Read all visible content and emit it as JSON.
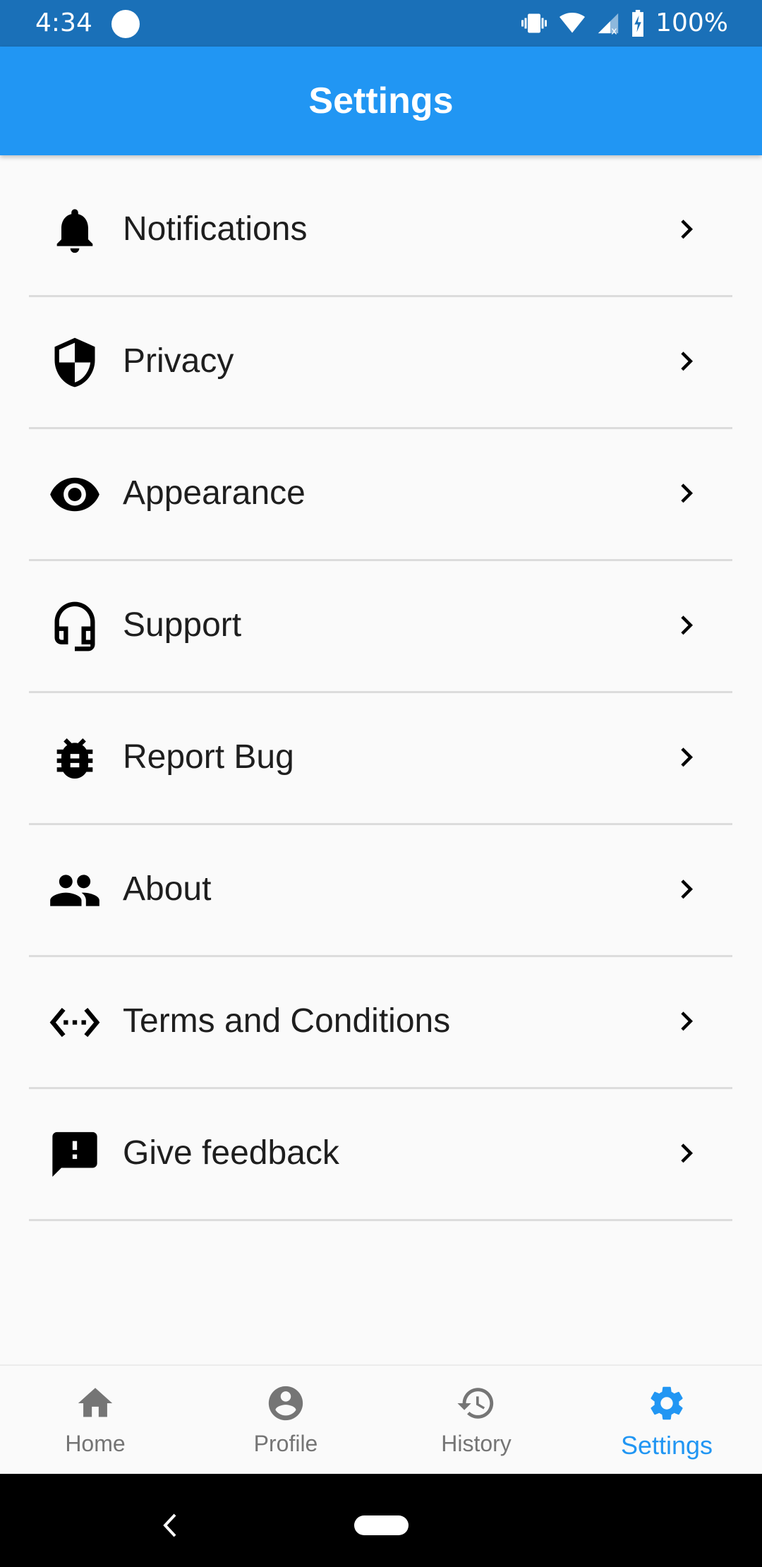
{
  "status_bar": {
    "time": "4:34",
    "battery": "100%"
  },
  "header": {
    "title": "Settings"
  },
  "settings": [
    {
      "label": "Notifications",
      "icon": "bell-icon"
    },
    {
      "label": "Privacy",
      "icon": "shield-icon"
    },
    {
      "label": "Appearance",
      "icon": "eye-icon"
    },
    {
      "label": "Support",
      "icon": "headset-icon"
    },
    {
      "label": "Report Bug",
      "icon": "bug-icon"
    },
    {
      "label": "About",
      "icon": "people-icon"
    },
    {
      "label": "Terms and Conditions",
      "icon": "code-dots-icon"
    },
    {
      "label": "Give feedback",
      "icon": "feedback-icon"
    }
  ],
  "bottom_nav": [
    {
      "label": "Home",
      "icon": "home-icon"
    },
    {
      "label": "Profile",
      "icon": "account-circle-icon"
    },
    {
      "label": "History",
      "icon": "history-icon"
    },
    {
      "label": "Settings",
      "icon": "gear-icon",
      "active": true
    }
  ],
  "colors": {
    "primary": "#2196F3",
    "status_bar": "#1A70B8",
    "inactive": "#757575"
  }
}
